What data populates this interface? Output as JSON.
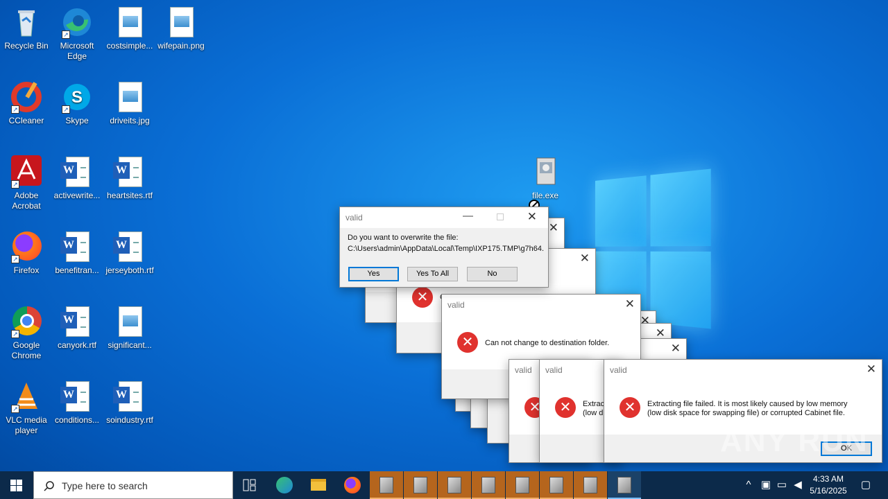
{
  "desktop": {
    "icons": [
      {
        "label": "Recycle Bin"
      },
      {
        "label": "Microsoft Edge"
      },
      {
        "label": "costsimple..."
      },
      {
        "label": "wifepain.png"
      },
      {
        "label": "CCleaner"
      },
      {
        "label": "Skype"
      },
      {
        "label": "driveits.jpg"
      },
      {
        "label": "Adobe Acrobat"
      },
      {
        "label": "activewrite..."
      },
      {
        "label": "heartsites.rtf"
      },
      {
        "label": "Firefox"
      },
      {
        "label": "benefitran..."
      },
      {
        "label": "jerseyboth.rtf"
      },
      {
        "label": "Google Chrome"
      },
      {
        "label": "canyork.rtf"
      },
      {
        "label": "significant..."
      },
      {
        "label": "VLC media player"
      },
      {
        "label": "conditions..."
      },
      {
        "label": "soindustry.rtf"
      },
      {
        "label": "file.exe"
      }
    ]
  },
  "dialogs": {
    "overwrite": {
      "title": "valid",
      "line1": "Do you want to overwrite the file:",
      "line2": "C:\\Users\\admin\\AppData\\Local\\Temp\\IXP175.TMP\\g7h64.",
      "yes": "Yes",
      "yes_all": "Yes To All",
      "no": "No"
    },
    "dest": {
      "title": "valid",
      "message": "Can not change to destination folder."
    },
    "extract_a": {
      "title": "valid"
    },
    "extract_b": {
      "title": "valid",
      "msg1": "Extrac",
      "msg2": "(low d"
    },
    "extract_c": {
      "title": "valid",
      "msg1": "Extracting file failed.  It is most likely caused by low memory",
      "msg2": "(low disk space for swapping file) or corrupted Cabinet file.",
      "ok": "OK"
    },
    "bg_peek": "C"
  },
  "taskbar": {
    "search_placeholder": "Type here to search",
    "time": "4:33 AM",
    "date": "5/16/2025"
  },
  "watermark": "ANY RUN",
  "icons_semantic": [
    "windows-start-icon",
    "search-icon",
    "task-view-icon",
    "edge-icon",
    "file-explorer-icon",
    "firefox-icon",
    "installer-icon",
    "chevron-up-icon",
    "network-icon",
    "volume-icon",
    "notification-icon",
    "error-icon",
    "close-icon"
  ]
}
